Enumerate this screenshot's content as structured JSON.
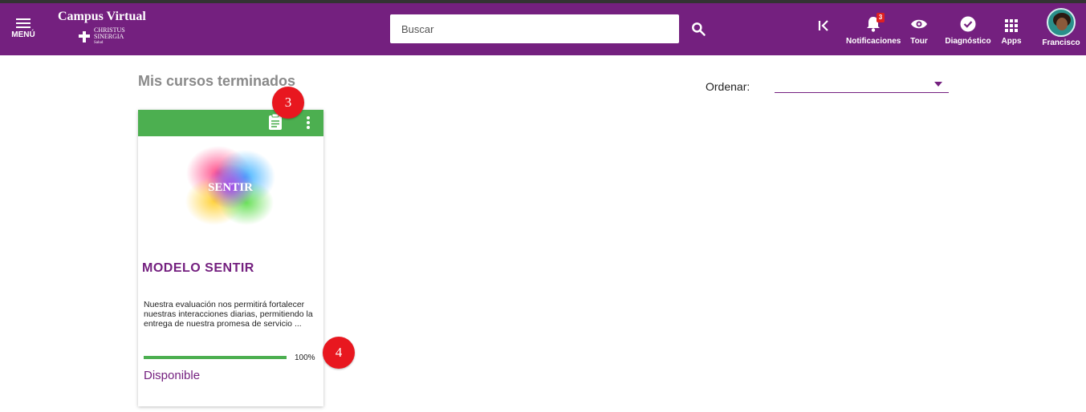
{
  "header": {
    "menu_label": "MENÚ",
    "brand_title": "Campus Virtual",
    "brand_sub_1": "CHRISTUS",
    "brand_sub_2": "SINERGIA",
    "brand_sub_3": "Salud",
    "search_placeholder": "Buscar",
    "notifications_label": "Notificaciones",
    "notifications_count": "3",
    "tour_label": "Tour",
    "diagnostic_label": "Diagnóstico",
    "apps_label": "Apps",
    "user_name": "Francisco"
  },
  "main": {
    "title": "Mis cursos terminados",
    "sort_label": "Ordenar:",
    "sort_value": ""
  },
  "course": {
    "image_text": "SENTIR",
    "title": "MODELO SENTIR",
    "description": "Nuestra evaluación nos permitirá fortalecer nuestras interacciones diarias, permitiendo la entrega de nuestra promesa de servicio ...",
    "progress": 100,
    "progress_label": "100%",
    "status": "Disponible"
  },
  "markers": {
    "m3": "3",
    "m4": "4"
  },
  "colors": {
    "primary": "#74207f",
    "card_header": "#4caf50",
    "marker": "#e8171f"
  }
}
